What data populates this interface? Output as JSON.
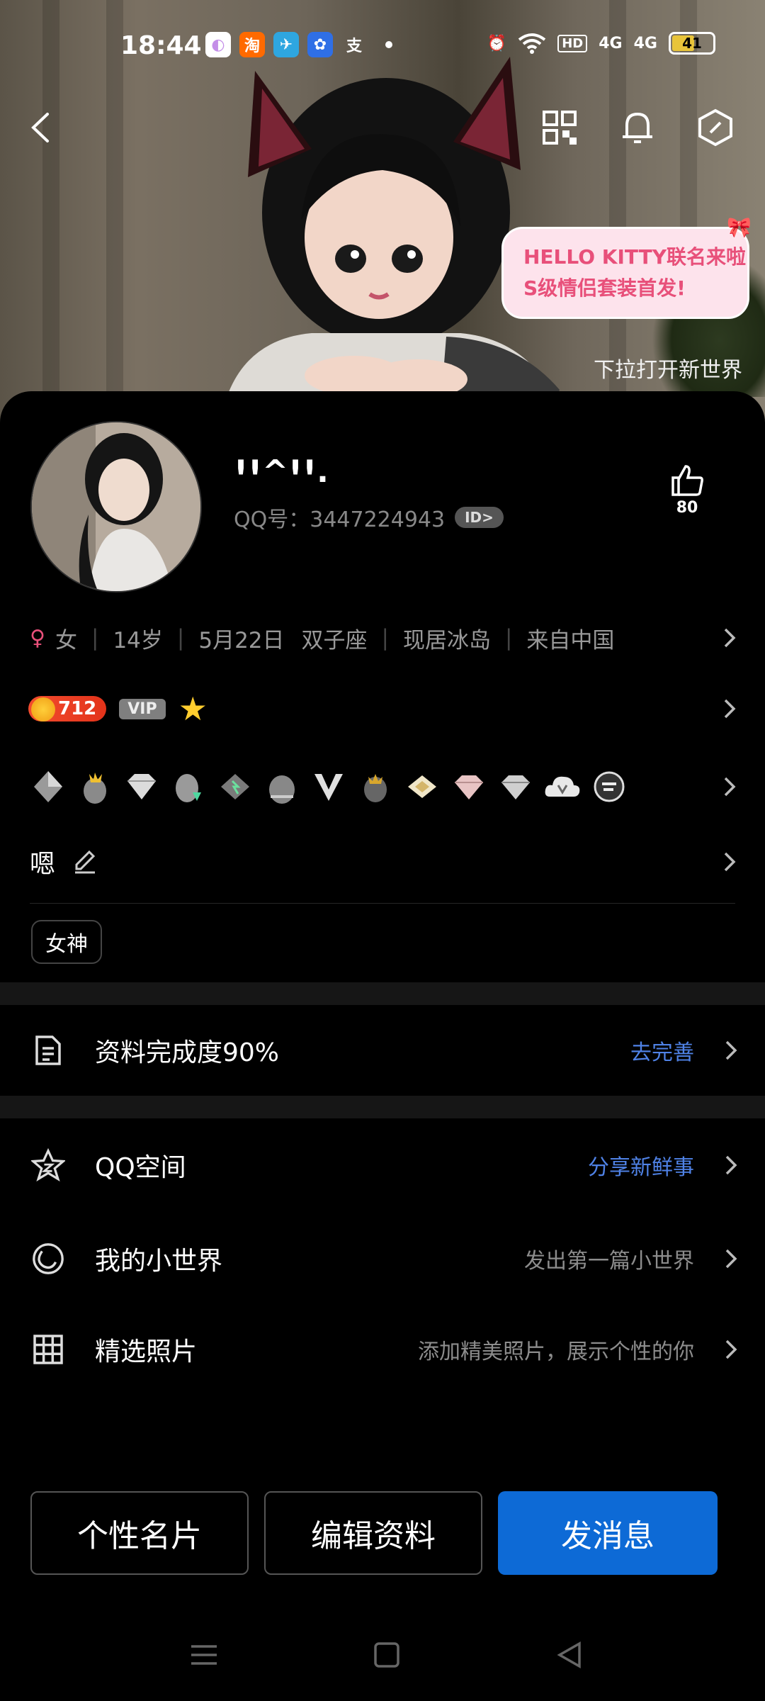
{
  "status_bar": {
    "time": "18:44",
    "app_icons": [
      {
        "name": "app-icon-1",
        "glyph": "◐",
        "bg": "#ffffff",
        "fg": "#c48ee8"
      },
      {
        "name": "taobao-icon",
        "glyph": "淘",
        "bg": "#ff6a00",
        "fg": "#ffffff"
      },
      {
        "name": "telegram-icon",
        "glyph": "✈",
        "bg": "#2ea6e0",
        "fg": "#ffffff"
      },
      {
        "name": "baidu-icon",
        "glyph": "✿",
        "bg": "#2f6fe6",
        "fg": "#ffffff"
      },
      {
        "name": "alipay-icon",
        "glyph": "支",
        "bg": "transparent",
        "fg": "#ffffff"
      }
    ],
    "network_1": "4G",
    "network_2": "4G",
    "hd_label": "HD",
    "battery": "41"
  },
  "hero": {
    "bubble_line1": "HELLO KITTY联名来啦",
    "bubble_line2": "S级情侣套装首发!",
    "pull_hint": "下拉打开新世界"
  },
  "profile": {
    "nickname": "ꞋꞋ^ꞋꞋ.",
    "qq_label": "QQ号：3447224943",
    "id_badge": "ID>",
    "likes": "80"
  },
  "info": {
    "gender": "女",
    "age": "14岁",
    "birthday": "5月22日",
    "zodiac": "双子座",
    "location": "现居冰岛",
    "origin": "来自中国"
  },
  "level": {
    "value": "712",
    "vip": "VIP"
  },
  "signature": {
    "text": "嗯"
  },
  "tags": [
    "女神"
  ],
  "completion": {
    "title": "资料完成度90%",
    "action": "去完善"
  },
  "list": [
    {
      "title": "QQ空间",
      "right": "分享新鲜事"
    },
    {
      "title": "我的小世界",
      "right": "发出第一篇小世界"
    },
    {
      "title": "精选照片",
      "right": "添加精美照片，展示个性的你"
    }
  ],
  "buttons": {
    "card": "个性名片",
    "edit": "编辑资料",
    "message": "发消息"
  },
  "colors": {
    "accent_blue": "#0d6ad6",
    "link_blue": "#4f82e6",
    "gender_pink": "#e8507a"
  }
}
